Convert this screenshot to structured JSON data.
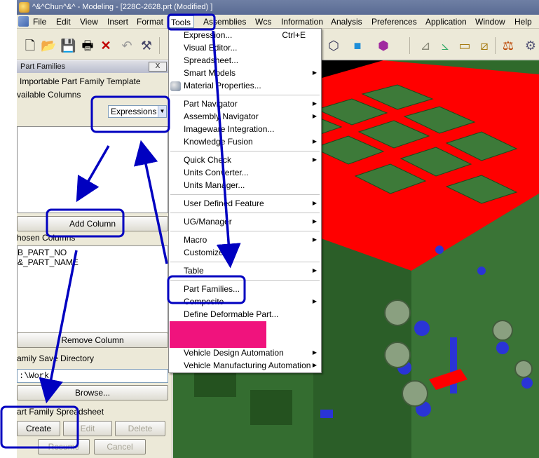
{
  "window": {
    "title": "^&^Chun^&^ - Modeling - [228C-2628.prt (Modified) ]"
  },
  "menubar": {
    "items": [
      {
        "label": "File"
      },
      {
        "label": "Edit"
      },
      {
        "label": "View"
      },
      {
        "label": "Insert"
      },
      {
        "label": "Format"
      },
      {
        "label": "Tools"
      },
      {
        "label": "Assemblies"
      },
      {
        "label": "Wcs"
      },
      {
        "label": "Information"
      },
      {
        "label": "Analysis"
      },
      {
        "label": "Preferences"
      },
      {
        "label": "Application"
      },
      {
        "label": "Window"
      },
      {
        "label": "Help"
      }
    ]
  },
  "tools_menu": {
    "items": [
      {
        "label": "Expression...",
        "shortcut": "Ctrl+E"
      },
      {
        "label": "Visual Editor..."
      },
      {
        "label": "Spreadsheet..."
      },
      {
        "label": "Smart Models",
        "submenu": true
      },
      {
        "label": "Material Properties..."
      },
      {
        "label": "Part Navigator",
        "submenu": true
      },
      {
        "label": "Assembly Navigator",
        "submenu": true
      },
      {
        "label": "Imageware Integration..."
      },
      {
        "label": "Knowledge Fusion",
        "submenu": true
      },
      {
        "label": "Quick Check",
        "submenu": true
      },
      {
        "label": "Units Converter..."
      },
      {
        "label": "Units Manager..."
      },
      {
        "label": "User Defined Feature",
        "submenu": true
      },
      {
        "label": "UG/Manager",
        "submenu": true
      },
      {
        "label": "Macro",
        "submenu": true
      },
      {
        "label": "Customize..."
      },
      {
        "label": "Table",
        "submenu": true
      },
      {
        "label": "Part Families..."
      },
      {
        "label": "Composite",
        "submenu": true
      },
      {
        "label": "Define Deformable Part..."
      },
      {
        "label": "Vehicle Design Automation",
        "submenu": true
      },
      {
        "label": "Vehicle Manufacturing Automation",
        "submenu": true
      }
    ]
  },
  "panel": {
    "title": "Part Families",
    "close_label": "X",
    "importable_label": "Importable Part Family Template",
    "available_label": "vailable Columns",
    "column_type_value": "Expressions",
    "add_column_label": "Add Column",
    "chosen_label": "hosen Columns",
    "chosen_columns": [
      "B_PART_NO",
      "&_PART_NAME"
    ],
    "remove_column_label": "Remove Column",
    "save_dir_label": "amily Save Directory",
    "save_dir_value": ":\\Work",
    "browse_label": "Browse...",
    "spreadsheet_label": "art Family Spreadsheet",
    "create_label": "Create",
    "edit_label": "Edit",
    "delete_label": "Delete",
    "resume_label": "Resume",
    "cancel_label": "Cancel"
  },
  "colors": {
    "annotation": "#0000c0",
    "model_green": "#2f6a2b",
    "model_red": "#ff0000",
    "highlight_pink": "#f0137d"
  }
}
